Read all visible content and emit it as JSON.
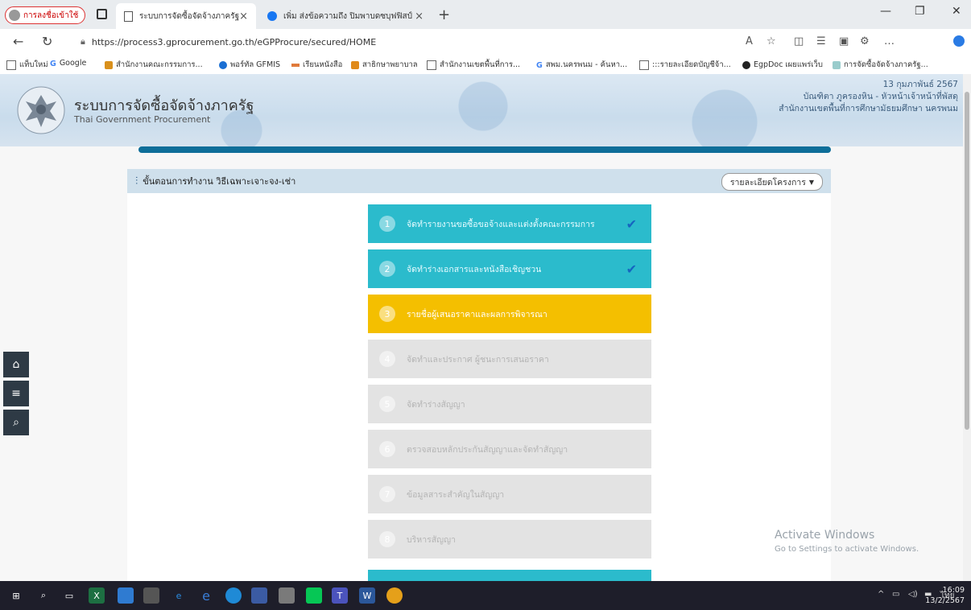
{
  "browser": {
    "profile_label": "การลงชื่อเข้าใช้",
    "tabs": [
      {
        "title": "ระบบการจัดซื้อจัดจ้างภาครัฐ"
      },
      {
        "title": "เพิ่ม ส่งข้อความถึง ปิมพาบดซบุฟฟิสป์"
      }
    ],
    "url": "https://process3.gprocurement.go.th/eGPProcure/secured/HOME",
    "bookmarks": [
      {
        "label": "แท็บใหม่"
      },
      {
        "label": "Google"
      },
      {
        "label": "สำนักงานคณะกรรมการ..."
      },
      {
        "label": "พอร์ทัล GFMIS"
      },
      {
        "label": "เรียนหนังสือ"
      },
      {
        "label": "สาธิกษาพยาบาล"
      },
      {
        "label": "สำนักงานเขตพื้นที่การ..."
      },
      {
        "label": "สพม.นครพนม - ค้นหา..."
      },
      {
        "label": ":::รายละเอียดบัญชีจ้า..."
      },
      {
        "label": "EgpDoc เผยแพร่เว็บ"
      },
      {
        "label": "การจัดซื้อจัดจ้างภาครัฐ..."
      }
    ]
  },
  "site": {
    "title": "ระบบการจัดซื้อจัดจ้างภาครัฐ",
    "subtitle": "Thai Government Procurement",
    "date": "13 กุมภาพันธ์ 2567",
    "user": "บัณฑิตา ภูครองหิน - หัวหน้าเจ้าหน้าที่พัสดุ",
    "org": "สำนักงานเขตพื้นที่การศึกษามัธยมศึกษา นครพนม"
  },
  "panel": {
    "title": "ขั้นตอนการทำงาน วิธีเฉพาะเจาะจง-เช่า",
    "detail_button": "รายละเอียดโครงการ"
  },
  "steps": [
    {
      "num": "1",
      "label": "จัดทำรายงานขอซื้อขอจ้างและแต่งตั้งคณะกรรมการ",
      "state": "done"
    },
    {
      "num": "2",
      "label": "จัดทำร่างเอกสารและหนังสือเชิญชวน",
      "state": "done"
    },
    {
      "num": "3",
      "label": "รายชื่อผู้เสนอราคาและผลการพิจารณา",
      "state": "current"
    },
    {
      "num": "4",
      "label": "จัดทำและประกาศ ผู้ชนะการเสนอราคา",
      "state": "todo"
    },
    {
      "num": "5",
      "label": "จัดทำร่างสัญญา",
      "state": "todo"
    },
    {
      "num": "6",
      "label": "ตรวจสอบหลักประกันสัญญาและจัดทำสัญญา",
      "state": "todo"
    },
    {
      "num": "7",
      "label": "ข้อมูลสาระสำคัญในสัญญา",
      "state": "todo"
    },
    {
      "num": "8",
      "label": "บริหารสัญญา",
      "state": "todo"
    }
  ],
  "watermark": {
    "line1": "Activate Windows",
    "line2": "Go to Settings to activate Windows."
  },
  "taskbar": {
    "lang": "ไทย",
    "time": "16:09",
    "date": "13/2/2567"
  },
  "colors": {
    "done": "#2bbbcc",
    "current": "#f4bf00",
    "todo": "#e3e3e3",
    "progress": "#0e6e99"
  }
}
